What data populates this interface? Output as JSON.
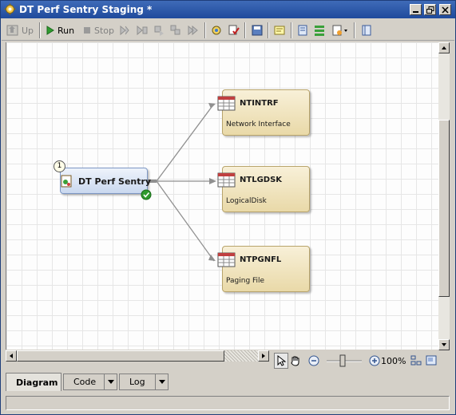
{
  "window": {
    "title": "DT Perf Sentry Staging *"
  },
  "toolbar": {
    "up_label": "Up",
    "run_label": "Run",
    "stop_label": "Stop"
  },
  "diagram": {
    "source_node": {
      "badge": "1",
      "name": "DT Perf Sentry"
    },
    "table_nodes": [
      {
        "name": "NTINTRF",
        "description": "Network Interface"
      },
      {
        "name": "NTLGDSK",
        "description": "LogicalDisk"
      },
      {
        "name": "NTPGNFL",
        "description": "Paging File"
      }
    ]
  },
  "zoom": {
    "level": "100%"
  },
  "tabs": [
    {
      "label": "Diagram",
      "active": true
    },
    {
      "label": "Code",
      "active": false
    },
    {
      "label": "Log",
      "active": false
    }
  ],
  "colors": {
    "titlebar": "#1f4a9c",
    "source_node": "#c9d8ef",
    "table_node": "#e9d9a8",
    "success_check": "#2e9a2e"
  }
}
